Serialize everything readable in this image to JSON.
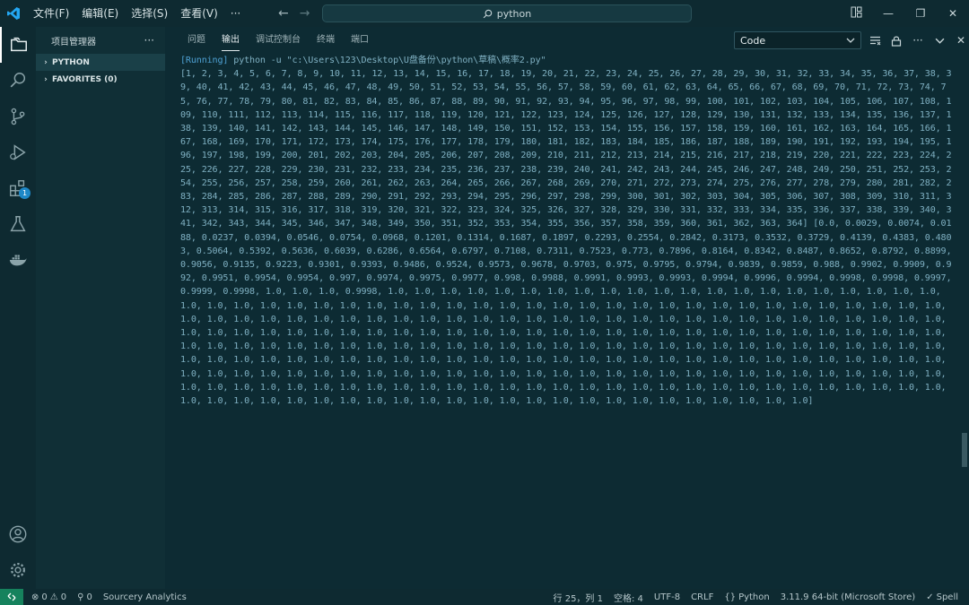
{
  "menu": [
    "文件(F)",
    "编辑(E)",
    "选择(S)",
    "查看(V)",
    "···"
  ],
  "search": {
    "text": "python"
  },
  "sidebar": {
    "title": "项目管理器",
    "more": "···",
    "sections": [
      {
        "label": "PYTHON"
      },
      {
        "label": "FAVORITES (0)"
      }
    ]
  },
  "activity": {
    "extensions_badge": "1"
  },
  "panel": {
    "tabs": [
      "问题",
      "输出",
      "调试控制台",
      "终端",
      "端口"
    ],
    "active_tab": "输出",
    "output_channel": "Code"
  },
  "output": {
    "run_tag": "[Running]",
    "command": " python -u \"c:\\Users\\123\\Desktop\\U盘备份\\python\\草稿\\概率2.py\"",
    "result": "[1, 2, 3, 4, 5, 6, 7, 8, 9, 10, 11, 12, 13, 14, 15, 16, 17, 18, 19, 20, 21, 22, 23, 24, 25, 26, 27, 28, 29, 30, 31, 32, 33, 34, 35, 36, 37, 38, 39, 40, 41, 42, 43, 44, 45, 46, 47, 48, 49, 50, 51, 52, 53, 54, 55, 56, 57, 58, 59, 60, 61, 62, 63, 64, 65, 66, 67, 68, 69, 70, 71, 72, 73, 74, 75, 76, 77, 78, 79, 80, 81, 82, 83, 84, 85, 86, 87, 88, 89, 90, 91, 92, 93, 94, 95, 96, 97, 98, 99, 100, 101, 102, 103, 104, 105, 106, 107, 108, 109, 110, 111, 112, 113, 114, 115, 116, 117, 118, 119, 120, 121, 122, 123, 124, 125, 126, 127, 128, 129, 130, 131, 132, 133, 134, 135, 136, 137, 138, 139, 140, 141, 142, 143, 144, 145, 146, 147, 148, 149, 150, 151, 152, 153, 154, 155, 156, 157, 158, 159, 160, 161, 162, 163, 164, 165, 166, 167, 168, 169, 170, 171, 172, 173, 174, 175, 176, 177, 178, 179, 180, 181, 182, 183, 184, 185, 186, 187, 188, 189, 190, 191, 192, 193, 194, 195, 196, 197, 198, 199, 200, 201, 202, 203, 204, 205, 206, 207, 208, 209, 210, 211, 212, 213, 214, 215, 216, 217, 218, 219, 220, 221, 222, 223, 224, 225, 226, 227, 228, 229, 230, 231, 232, 233, 234, 235, 236, 237, 238, 239, 240, 241, 242, 243, 244, 245, 246, 247, 248, 249, 250, 251, 252, 253, 254, 255, 256, 257, 258, 259, 260, 261, 262, 263, 264, 265, 266, 267, 268, 269, 270, 271, 272, 273, 274, 275, 276, 277, 278, 279, 280, 281, 282, 283, 284, 285, 286, 287, 288, 289, 290, 291, 292, 293, 294, 295, 296, 297, 298, 299, 300, 301, 302, 303, 304, 305, 306, 307, 308, 309, 310, 311, 312, 313, 314, 315, 316, 317, 318, 319, 320, 321, 322, 323, 324, 325, 326, 327, 328, 329, 330, 331, 332, 333, 334, 335, 336, 337, 338, 339, 340, 341, 342, 343, 344, 345, 346, 347, 348, 349, 350, 351, 352, 353, 354, 355, 356, 357, 358, 359, 360, 361, 362, 363, 364] [0.0, 0.0029, 0.0074, 0.0188, 0.0237, 0.0394, 0.0546, 0.0754, 0.0968, 0.1201, 0.1314, 0.1687, 0.1897, 0.2293, 0.2554, 0.2842, 0.3173, 0.3532, 0.3729, 0.4139, 0.4383, 0.4803, 0.5064, 0.5392, 0.5636, 0.6039, 0.6286, 0.6564, 0.6797, 0.7108, 0.7311, 0.7523, 0.773, 0.7896, 0.8164, 0.8342, 0.8487, 0.8652, 0.8792, 0.8899, 0.9056, 0.9135, 0.9223, 0.9301, 0.9393, 0.9486, 0.9524, 0.9573, 0.9678, 0.9703, 0.975, 0.9795, 0.9794, 0.9839, 0.9859, 0.988, 0.9902, 0.9909, 0.992, 0.9951, 0.9954, 0.9954, 0.997, 0.9974, 0.9975, 0.9977, 0.998, 0.9988, 0.9991, 0.9993, 0.9993, 0.9994, 0.9996, 0.9994, 0.9998, 0.9998, 0.9997, 0.9999, 0.9998, 1.0, 1.0, 1.0, 0.9998, 1.0, 1.0, 1.0, 1.0, 1.0, 1.0, 1.0, 1.0, 1.0, 1.0, 1.0, 1.0, 1.0, 1.0, 1.0, 1.0, 1.0, 1.0, 1.0, 1.0, 1.0, 1.0, 1.0, 1.0, 1.0, 1.0, 1.0, 1.0, 1.0, 1.0, 1.0, 1.0, 1.0, 1.0, 1.0, 1.0, 1.0, 1.0, 1.0, 1.0, 1.0, 1.0, 1.0, 1.0, 1.0, 1.0, 1.0, 1.0, 1.0, 1.0, 1.0, 1.0, 1.0, 1.0, 1.0, 1.0, 1.0, 1.0, 1.0, 1.0, 1.0, 1.0, 1.0, 1.0, 1.0, 1.0, 1.0, 1.0, 1.0, 1.0, 1.0, 1.0, 1.0, 1.0, 1.0, 1.0, 1.0, 1.0, 1.0, 1.0, 1.0, 1.0, 1.0, 1.0, 1.0, 1.0, 1.0, 1.0, 1.0, 1.0, 1.0, 1.0, 1.0, 1.0, 1.0, 1.0, 1.0, 1.0, 1.0, 1.0, 1.0, 1.0, 1.0, 1.0, 1.0, 1.0, 1.0, 1.0, 1.0, 1.0, 1.0, 1.0, 1.0, 1.0, 1.0, 1.0, 1.0, 1.0, 1.0, 1.0, 1.0, 1.0, 1.0, 1.0, 1.0, 1.0, 1.0, 1.0, 1.0, 1.0, 1.0, 1.0, 1.0, 1.0, 1.0, 1.0, 1.0, 1.0, 1.0, 1.0, 1.0, 1.0, 1.0, 1.0, 1.0, 1.0, 1.0, 1.0, 1.0, 1.0, 1.0, 1.0, 1.0, 1.0, 1.0, 1.0, 1.0, 1.0, 1.0, 1.0, 1.0, 1.0, 1.0, 1.0, 1.0, 1.0, 1.0, 1.0, 1.0, 1.0, 1.0, 1.0, 1.0, 1.0, 1.0, 1.0, 1.0, 1.0, 1.0, 1.0, 1.0, 1.0, 1.0, 1.0, 1.0, 1.0, 1.0, 1.0, 1.0, 1.0, 1.0, 1.0, 1.0, 1.0, 1.0, 1.0, 1.0, 1.0, 1.0, 1.0, 1.0, 1.0, 1.0, 1.0, 1.0, 1.0, 1.0, 1.0, 1.0, 1.0, 1.0, 1.0, 1.0, 1.0, 1.0, 1.0, 1.0, 1.0, 1.0, 1.0, 1.0, 1.0, 1.0, 1.0, 1.0, 1.0, 1.0, 1.0, 1.0, 1.0, 1.0, 1.0, 1.0, 1.0, 1.0, 1.0, 1.0, 1.0, 1.0, 1.0, 1.0, 1.0, 1.0, 1.0, 1.0, 1.0, 1.0, 1.0]"
  },
  "status": {
    "errors": "0",
    "warnings": "0",
    "ports": "0",
    "sourcery": "Sourcery Analytics",
    "position": "行 25，列 1",
    "spaces": "空格: 4",
    "encoding": "UTF-8",
    "eol": "CRLF",
    "language": "Python",
    "interpreter": "3.11.9 64-bit (Microsoft Store)",
    "spell": "Spell"
  }
}
